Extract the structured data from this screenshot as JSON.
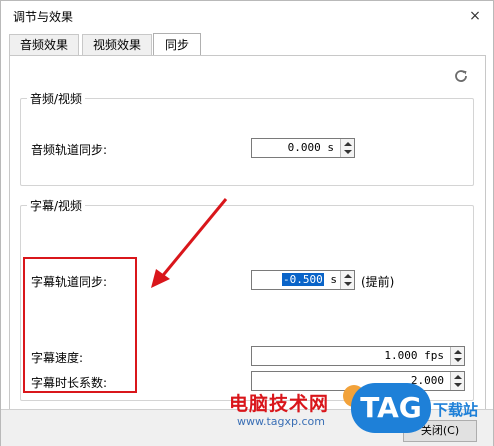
{
  "window": {
    "title": "调节与效果",
    "close_glyph": "×"
  },
  "tabs": [
    {
      "label": "音频效果",
      "active": false
    },
    {
      "label": "视频效果",
      "active": false
    },
    {
      "label": "同步",
      "active": true
    }
  ],
  "refresh_icon": "refresh-icon",
  "audio_video": {
    "legend": "音频/视频",
    "audio_track_sync_label": "音频轨道同步:",
    "audio_track_sync_value": "0.000 s"
  },
  "subtitle_video": {
    "legend": "字幕/视频",
    "subtitle_track_sync_label": "字幕轨道同步:",
    "subtitle_track_sync_value": "-0.500",
    "subtitle_track_sync_unit": "s",
    "subtitle_track_sync_note": "(提前)",
    "subtitle_speed_label": "字幕速度:",
    "subtitle_speed_value": "1.000 fps",
    "subtitle_duration_factor_label": "字幕时长系数:",
    "subtitle_duration_factor_value": "2.000"
  },
  "bottom": {
    "close_button": "关闭(C)"
  },
  "watermark": {
    "site_name": "电脑技术网",
    "site_url": "www.tagxp.com",
    "badge": "TAG",
    "tail": "下载站"
  },
  "colors": {
    "annotation_red": "#d9161b",
    "selection_blue": "#0a64c8",
    "watermark_blue": "#1e80d8"
  }
}
